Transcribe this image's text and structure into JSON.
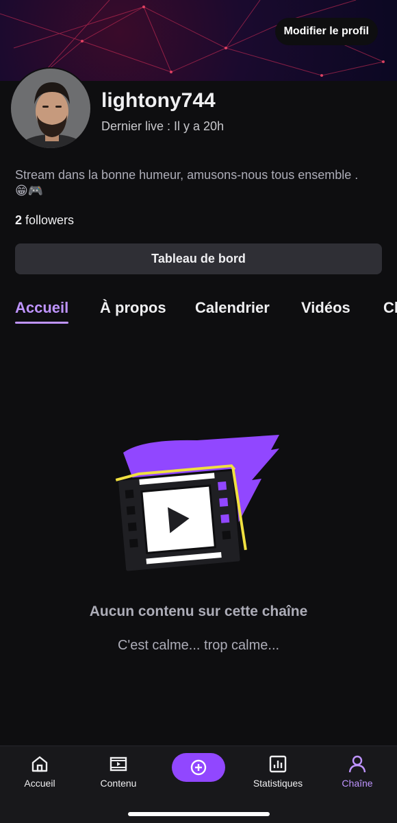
{
  "header": {
    "edit_profile_label": "Modifier le profil"
  },
  "profile": {
    "username": "lightony744",
    "last_live": "Dernier live : Il y a 20h",
    "bio": "Stream dans la bonne humeur, amusons-nous tous ensemble . 😁🎮",
    "followers_count": "2",
    "followers_label": "followers"
  },
  "dashboard_label": "Tableau de bord",
  "tabs": [
    {
      "label": "Accueil",
      "active": true
    },
    {
      "label": "À propos"
    },
    {
      "label": "Calendrier"
    },
    {
      "label": "Vidéos"
    },
    {
      "label": "Cl"
    }
  ],
  "empty_state": {
    "title": "Aucun contenu sur cette chaîne",
    "subtitle": "C'est calme... trop calme..."
  },
  "bottom_nav": [
    {
      "label": "Accueil",
      "icon": "home-icon"
    },
    {
      "label": "Contenu",
      "icon": "film-icon"
    },
    {
      "label": "",
      "icon": "plus-circle-icon"
    },
    {
      "label": "Statistiques",
      "icon": "stats-icon"
    },
    {
      "label": "Chaîne",
      "icon": "user-icon",
      "active": true
    }
  ],
  "colors": {
    "accent": "#bf94ff",
    "brand": "#9147ff",
    "background": "#0e0e10",
    "surface": "#2f2f35"
  }
}
